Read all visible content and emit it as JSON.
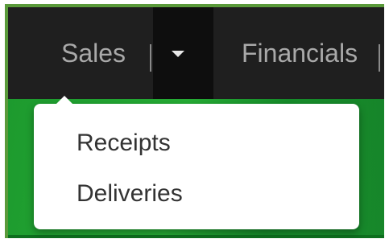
{
  "nav": {
    "items": [
      {
        "label": "Sales"
      },
      {
        "label": "Financials"
      }
    ],
    "caret_icon": "caret-down-icon"
  },
  "dropdown": {
    "items": [
      {
        "label": "Receipts"
      },
      {
        "label": "Deliveries"
      }
    ]
  },
  "colors": {
    "navbar_bg": "#1f1f1f",
    "nav_text": "#a9a9a9",
    "accent_green": "#26ad35",
    "frame_border": "#5a9a3a",
    "menu_text": "#333333"
  }
}
